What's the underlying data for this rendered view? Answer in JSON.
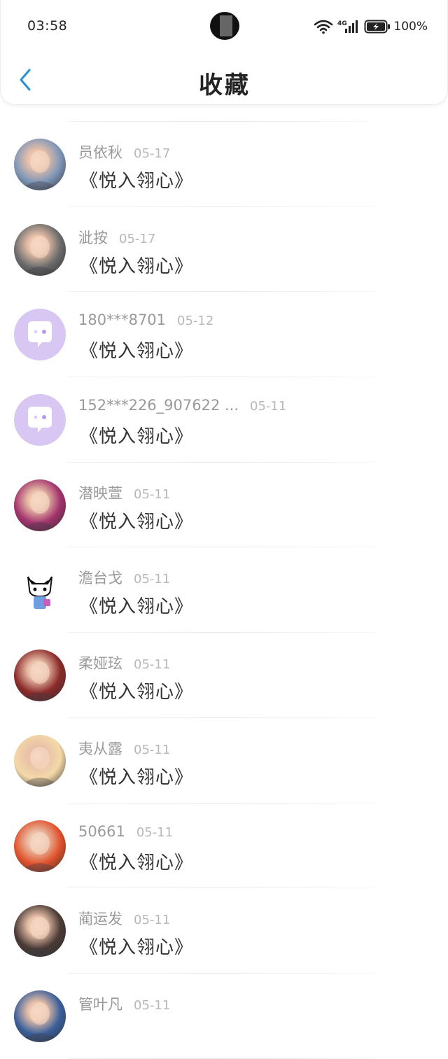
{
  "status_bar": {
    "time": "03:58",
    "signal_label": "4G",
    "battery_percent": "100%"
  },
  "nav": {
    "title": "收藏",
    "back_icon": "chevron-left-icon"
  },
  "colors": {
    "accent": "#2b8fd6",
    "name_text": "#9a9a9a",
    "date_text": "#b8b8b8",
    "book_text": "#333333",
    "default_avatar_bg": "#d9c7f3"
  },
  "favorites": [
    {
      "user": "员依秋",
      "date": "05-17",
      "book": "《悦入翎心》",
      "avatar": "photo-avatar",
      "avatar_color": "#7e96b8"
    },
    {
      "user": "泚按",
      "date": "05-17",
      "book": "《悦入翎心》",
      "avatar": "anime-avatar",
      "avatar_color": "#6b6b6b"
    },
    {
      "user": "180***8701",
      "date": "05-12",
      "book": "《悦入翎心》",
      "avatar": "default-chat-avatar",
      "avatar_color": "#d9c7f3"
    },
    {
      "user": "152***226_907622 ...",
      "date": "05-11",
      "book": "《悦入翎心》",
      "avatar": "default-chat-avatar",
      "avatar_color": "#d9c7f3"
    },
    {
      "user": "潜映萱",
      "date": "05-11",
      "book": "《悦入翎心》",
      "avatar": "photo-avatar",
      "avatar_color": "#a2326c"
    },
    {
      "user": "澹台戈",
      "date": "05-11",
      "book": "《悦入翎心》",
      "avatar": "cartoon-cat-avatar",
      "avatar_color": "#ffffff"
    },
    {
      "user": "柔娅玹",
      "date": "05-11",
      "book": "《悦入翎心》",
      "avatar": "photo-avatar",
      "avatar_color": "#8b2a2a"
    },
    {
      "user": "夷从露",
      "date": "05-11",
      "book": "《悦入翎心》",
      "avatar": "anime-avatar",
      "avatar_color": "#f4d9a8"
    },
    {
      "user": "50661",
      "date": "05-11",
      "book": "《悦入翎心》",
      "avatar": "photo-avatar",
      "avatar_color": "#e0522c"
    },
    {
      "user": "蔺运发",
      "date": "05-11",
      "book": "《悦入翎心》",
      "avatar": "photo-avatar",
      "avatar_color": "#4a3a36"
    },
    {
      "user": "管叶凡",
      "date": "05-11",
      "book": "",
      "avatar": "photo-avatar",
      "avatar_color": "#3a5f9a"
    }
  ]
}
